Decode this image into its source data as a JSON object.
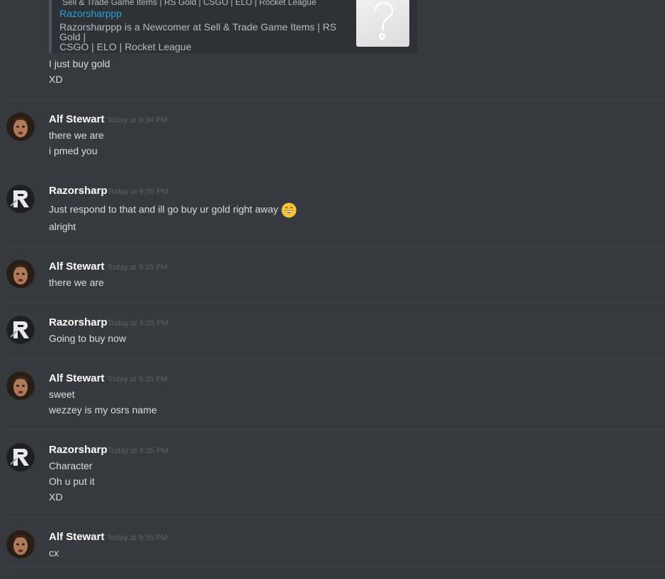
{
  "embed": {
    "cut_line": "Sell & Trade Game Items | RS Gold | CSGO | ELO | Rocket League",
    "title": "Razorsharppp",
    "description_line1": "Razorsharppp is a Newcomer at Sell & Trade Game Items | RS Gold |",
    "description_line2": "CSGO | ELO | Rocket League",
    "thumbnail_icon": "question-mark-icon"
  },
  "trailing_lines": [
    "I just buy gold",
    "XD"
  ],
  "messages": [
    {
      "author": "Alf Stewart",
      "timestamp": "Today at 9:34 PM",
      "lines": [
        "there we are",
        "i pmed you"
      ]
    },
    {
      "author": "Razorsharp",
      "timestamp": "Today at 9:35 PM",
      "lines": [
        "Just respond to that and ill go buy ur gold right away",
        "alright"
      ],
      "emoji": "grinning-face-emoji"
    },
    {
      "author": "Alf Stewart",
      "timestamp": "Today at 9:35 PM",
      "lines": [
        "there we are"
      ]
    },
    {
      "author": "Razorsharp",
      "timestamp": "Today at 9:35 PM",
      "lines": [
        "Going to buy now"
      ]
    },
    {
      "author": "Alf Stewart",
      "timestamp": "Today at 9:35 PM",
      "lines": [
        "sweet",
        "wezzey is my osrs name"
      ]
    },
    {
      "author": "Razorsharp",
      "timestamp": "Today at 9:35 PM",
      "lines": [
        "Character",
        "Oh u put it",
        "XD"
      ]
    },
    {
      "author": "Alf Stewart",
      "timestamp": "Today at 9:35 PM",
      "lines": [
        "cx"
      ]
    }
  ],
  "colors": {
    "background": "#36393e",
    "link": "#2ba3d6",
    "username": "#ffffff",
    "message_text": "#dcddde",
    "timestamp": "#5d6067"
  }
}
